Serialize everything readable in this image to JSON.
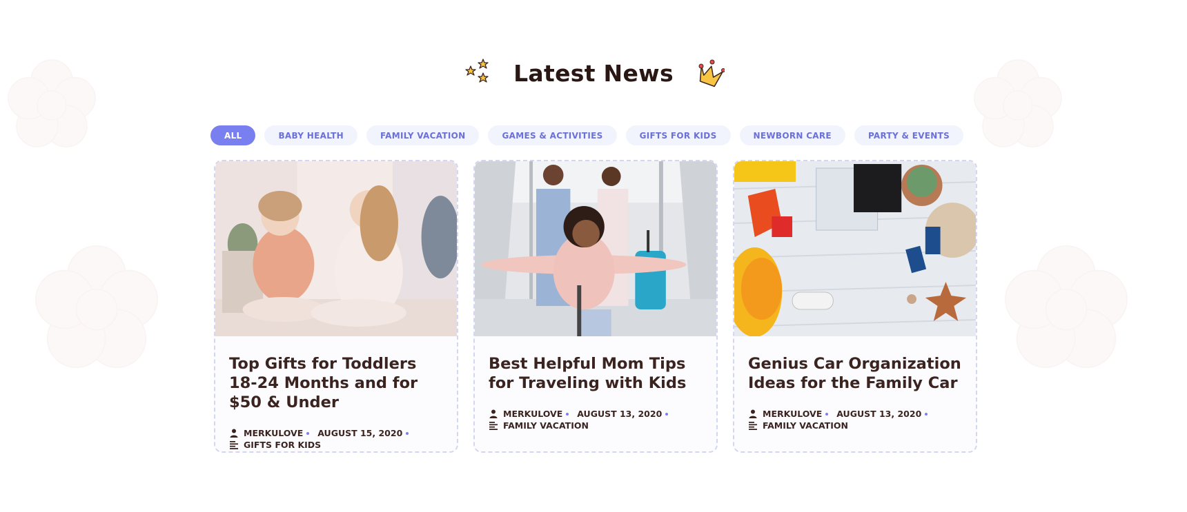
{
  "section": {
    "title": "Latest News",
    "left_decor_icon": "stars-icon",
    "right_decor_icon": "crown-icon"
  },
  "tabs": [
    {
      "label": "ALL",
      "active": true
    },
    {
      "label": "BABY HEALTH",
      "active": false
    },
    {
      "label": "FAMILY VACATION",
      "active": false
    },
    {
      "label": "GAMES & ACTIVITIES",
      "active": false
    },
    {
      "label": "GIFTS FOR KIDS",
      "active": false
    },
    {
      "label": "NEWBORN CARE",
      "active": false
    },
    {
      "label": "PARTY & EVENTS",
      "active": false
    }
  ],
  "posts": [
    {
      "title": "Top Gifts for Toddlers 18-24 Months and for $50 & Under",
      "author": "MERKULOVE",
      "date": "AUGUST 15, 2020",
      "category": "GIFTS FOR KIDS",
      "image": "two girls playing with makeup"
    },
    {
      "title": "Best Helpful Mom Tips for Traveling with Kids",
      "author": "MERKULOVE",
      "date": "AUGUST 13, 2020",
      "category": "FAMILY VACATION",
      "image": "family traveling at airport with luggage"
    },
    {
      "title": "Genius Car Organization Ideas for the Family Car",
      "author": "MERKULOVE",
      "date": "AUGUST 13, 2020",
      "category": "FAMILY VACATION",
      "image": "travel items flat lay on wooden table"
    }
  ],
  "colors": {
    "accent": "#7a7ff0",
    "tab_bg": "#f1f3fd",
    "title_text": "#3b2420",
    "card_border": "#d3d6f2"
  }
}
